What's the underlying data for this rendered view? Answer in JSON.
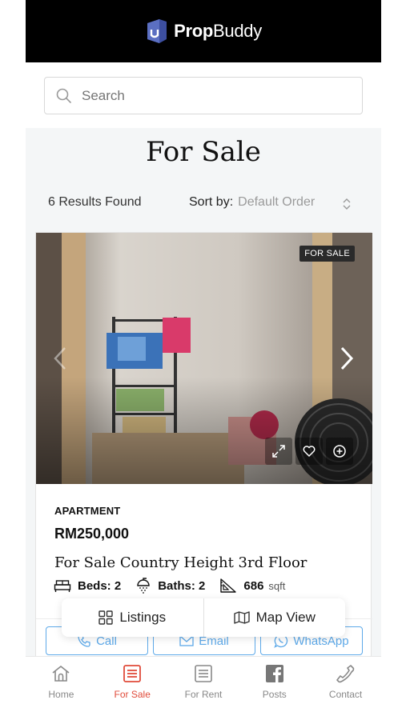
{
  "app": {
    "brand_bold": "Prop",
    "brand_regular": "Buddy"
  },
  "search": {
    "placeholder": "Search"
  },
  "page": {
    "title": "For Sale"
  },
  "results": {
    "count_text": "6 Results Found",
    "sort_label": "Sort by:",
    "sort_value": "Default Order"
  },
  "listing": {
    "badge": "FOR SALE",
    "type": "APARTMENT",
    "price": "RM250,000",
    "title": "For Sale Country Height 3rd Floor",
    "beds_label": "Beds:",
    "beds": "2",
    "baths_label": "Baths:",
    "baths": "2",
    "area": "686",
    "area_unit": "sqft",
    "actions": {
      "call": "Call",
      "email": "Email",
      "whatsapp": "WhatsApp"
    }
  },
  "view_toggle": {
    "listings": "Listings",
    "map": "Map View"
  },
  "nav": {
    "active": "For Sale",
    "accent_color": "#e04b3a",
    "items": [
      {
        "label": "Home",
        "icon": "home-icon"
      },
      {
        "label": "For Sale",
        "icon": "list-icon"
      },
      {
        "label": "For Rent",
        "icon": "list-icon"
      },
      {
        "label": "Posts",
        "icon": "facebook-icon"
      },
      {
        "label": "Contact",
        "icon": "phone-icon"
      }
    ]
  }
}
